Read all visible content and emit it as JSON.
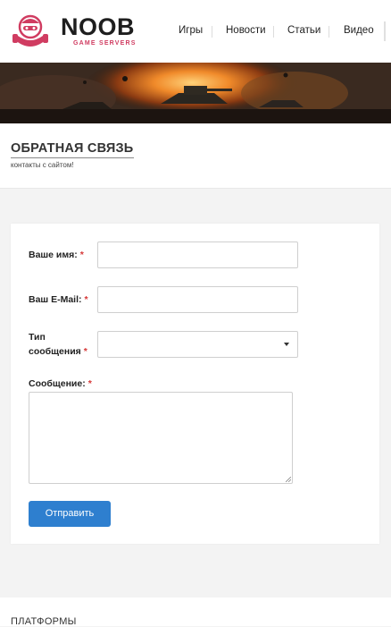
{
  "logo": {
    "name": "NOOB",
    "tagline": "GAME SERVERS"
  },
  "nav": {
    "items": [
      {
        "label": "Игры"
      },
      {
        "label": "Новости"
      },
      {
        "label": "Статьи"
      },
      {
        "label": "Видео"
      }
    ]
  },
  "page": {
    "title": "ОБРАТНАЯ СВЯЗЬ",
    "subtitle": "контакты с сайтом!"
  },
  "form": {
    "name_label": "Ваше имя:",
    "email_label": "Ваш E-Mail:",
    "type_label_line1": "Тип",
    "type_label_line2": "сообщения",
    "message_label": "Сообщение:",
    "required_mark": "*",
    "name_value": "",
    "email_value": "",
    "type_value": "",
    "message_value": "",
    "submit_label": "Отправить"
  },
  "footer": {
    "title": "ПЛАТФОРМЫ"
  },
  "colors": {
    "accent": "#2e7fcf",
    "brand": "#d03c61",
    "required": "#d63838"
  }
}
